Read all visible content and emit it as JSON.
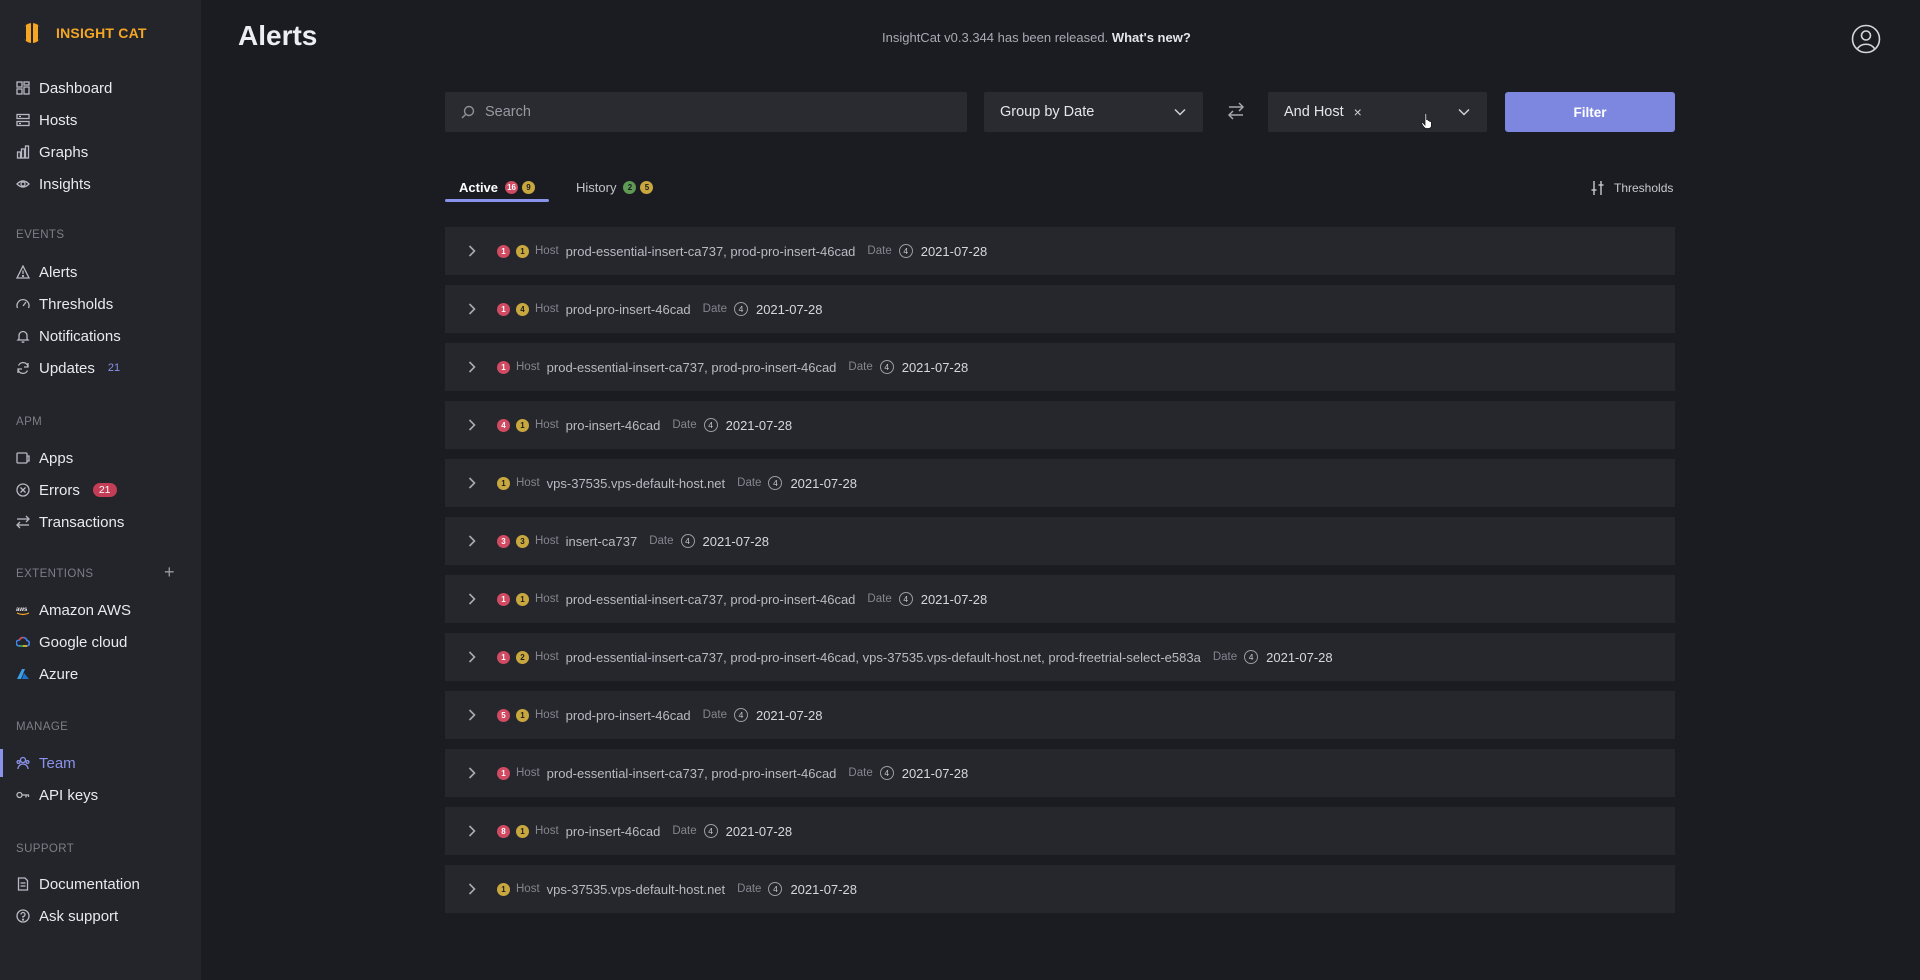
{
  "brand": {
    "name": "INSIGHT CAT"
  },
  "sidebar": {
    "main": [
      {
        "label": "Dashboard",
        "icon": "dashboard-icon"
      },
      {
        "label": "Hosts",
        "icon": "hosts-icon"
      },
      {
        "label": "Graphs",
        "icon": "graph-icon"
      },
      {
        "label": "Insights",
        "icon": "eye-icon"
      }
    ],
    "events": {
      "heading": "EVENTS",
      "items": [
        {
          "label": "Alerts",
          "icon": "warning-icon"
        },
        {
          "label": "Thresholds",
          "icon": "gauge-icon"
        },
        {
          "label": "Notifications",
          "icon": "bell-icon"
        },
        {
          "label": "Updates",
          "icon": "refresh-icon",
          "count": "21"
        }
      ]
    },
    "apm": {
      "heading": "APM",
      "items": [
        {
          "label": "Apps",
          "icon": "apps-icon"
        },
        {
          "label": "Errors",
          "icon": "error-icon",
          "count": "21"
        },
        {
          "label": "Transactions",
          "icon": "swap-icon"
        }
      ]
    },
    "extensions": {
      "heading": "EXTENTIONS",
      "add_label": "+",
      "items": [
        {
          "label": "Amazon AWS",
          "icon": "aws-icon"
        },
        {
          "label": "Google cloud",
          "icon": "google-cloud-icon"
        },
        {
          "label": "Azure",
          "icon": "azure-icon"
        }
      ]
    },
    "manage": {
      "heading": "MANAGE",
      "items": [
        {
          "label": "Team",
          "icon": "team-icon",
          "active": true
        },
        {
          "label": "API keys",
          "icon": "key-icon"
        }
      ]
    },
    "support": {
      "heading": "SUPPORT",
      "items": [
        {
          "label": "Documentation",
          "icon": "document-icon"
        },
        {
          "label": "Ask support",
          "icon": "help-icon"
        }
      ]
    }
  },
  "header": {
    "title": "Alerts",
    "release_text": "InsightCat v0.3.344 has been released.",
    "release_link": "What's new?"
  },
  "filters": {
    "search_placeholder": "Search",
    "group_by": "Group by Date",
    "tag": "And Host",
    "tag_remove": "×",
    "filter_button": "Filter"
  },
  "tabs": {
    "active": {
      "label": "Active",
      "red": "16",
      "yellow": "9"
    },
    "history": {
      "label": "History",
      "green": "2",
      "yellow": "5"
    },
    "thresholds_label": "Thresholds"
  },
  "colors": {
    "accent": "#8a93ea",
    "brand": "#f5a623",
    "danger": "#d04a62",
    "warning": "#c8a73f",
    "success": "#5f9a55"
  },
  "alerts": [
    {
      "red": "1",
      "yellow": "1",
      "host_label": "Host",
      "hosts": "prod-essential-insert-ca737, prod-pro-insert-46cad",
      "date_label": "Date",
      "date_count": "4",
      "date": "2021-07-28"
    },
    {
      "red": "1",
      "yellow": "4",
      "host_label": "Host",
      "hosts": "prod-pro-insert-46cad",
      "date_label": "Date",
      "date_count": "4",
      "date": "2021-07-28"
    },
    {
      "red": "1",
      "yellow": null,
      "host_label": "Host",
      "hosts": "prod-essential-insert-ca737, prod-pro-insert-46cad",
      "date_label": "Date",
      "date_count": "4",
      "date": "2021-07-28"
    },
    {
      "red": "4",
      "yellow": "1",
      "host_label": "Host",
      "hosts": "pro-insert-46cad",
      "date_label": "Date",
      "date_count": "4",
      "date": "2021-07-28"
    },
    {
      "red": null,
      "yellow": "1",
      "host_label": "Host",
      "hosts": "vps-37535.vps-default-host.net",
      "date_label": "Date",
      "date_count": "4",
      "date": "2021-07-28"
    },
    {
      "red": "3",
      "yellow": "3",
      "host_label": "Host",
      "hosts": "insert-ca737",
      "date_label": "Date",
      "date_count": "4",
      "date": "2021-07-28"
    },
    {
      "red": "1",
      "yellow": "1",
      "host_label": "Host",
      "hosts": "prod-essential-insert-ca737, prod-pro-insert-46cad",
      "date_label": "Date",
      "date_count": "4",
      "date": "2021-07-28"
    },
    {
      "red": "1",
      "yellow": "2",
      "host_label": "Host",
      "hosts": "prod-essential-insert-ca737, prod-pro-insert-46cad, vps-37535.vps-default-host.net, prod-freetrial-select-e583a",
      "date_label": "Date",
      "date_count": "4",
      "date": "2021-07-28"
    },
    {
      "red": "5",
      "yellow": "1",
      "host_label": "Host",
      "hosts": "prod-pro-insert-46cad",
      "date_label": "Date",
      "date_count": "4",
      "date": "2021-07-28"
    },
    {
      "red": "1",
      "yellow": null,
      "host_label": "Host",
      "hosts": "prod-essential-insert-ca737, prod-pro-insert-46cad",
      "date_label": "Date",
      "date_count": "4",
      "date": "2021-07-28"
    },
    {
      "red": "8",
      "yellow": "1",
      "host_label": "Host",
      "hosts": "pro-insert-46cad",
      "date_label": "Date",
      "date_count": "4",
      "date": "2021-07-28"
    },
    {
      "red": null,
      "yellow": "1",
      "host_label": "Host",
      "hosts": "vps-37535.vps-default-host.net",
      "date_label": "Date",
      "date_count": "4",
      "date": "2021-07-28"
    }
  ]
}
